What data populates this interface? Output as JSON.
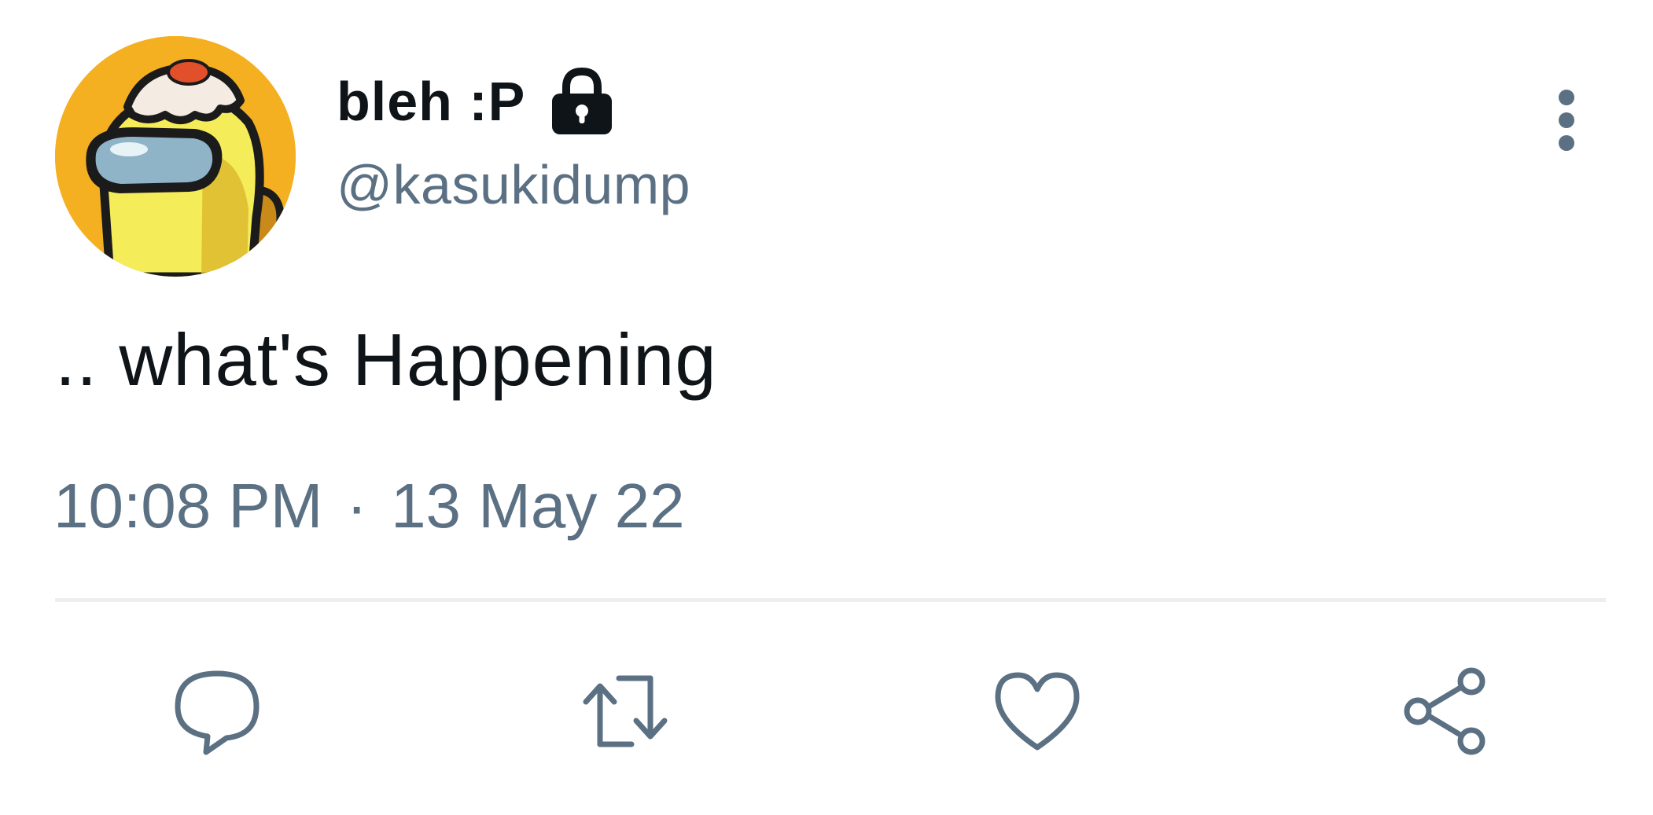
{
  "tweet": {
    "author": {
      "display_name": "bleh :P",
      "handle": "@kasukidump",
      "avatar_icon": "crewmate-avatar",
      "protected_icon": "lock-icon"
    },
    "text": ".. what's Happening",
    "time": "10:08 PM",
    "separator": "·",
    "date": "13 May 22"
  },
  "actions": {
    "reply_icon": "reply-icon",
    "retweet_icon": "retweet-icon",
    "like_icon": "like-icon",
    "share_icon": "share-icon",
    "more_icon": "more-vertical-icon"
  },
  "colors": {
    "text_primary": "#0f1419",
    "text_secondary": "#5b7083",
    "divider": "#eceef0",
    "avatar_background": "#f5b021",
    "crewmate_body": "#f5ec5a",
    "visor": "#8fb3c7"
  }
}
